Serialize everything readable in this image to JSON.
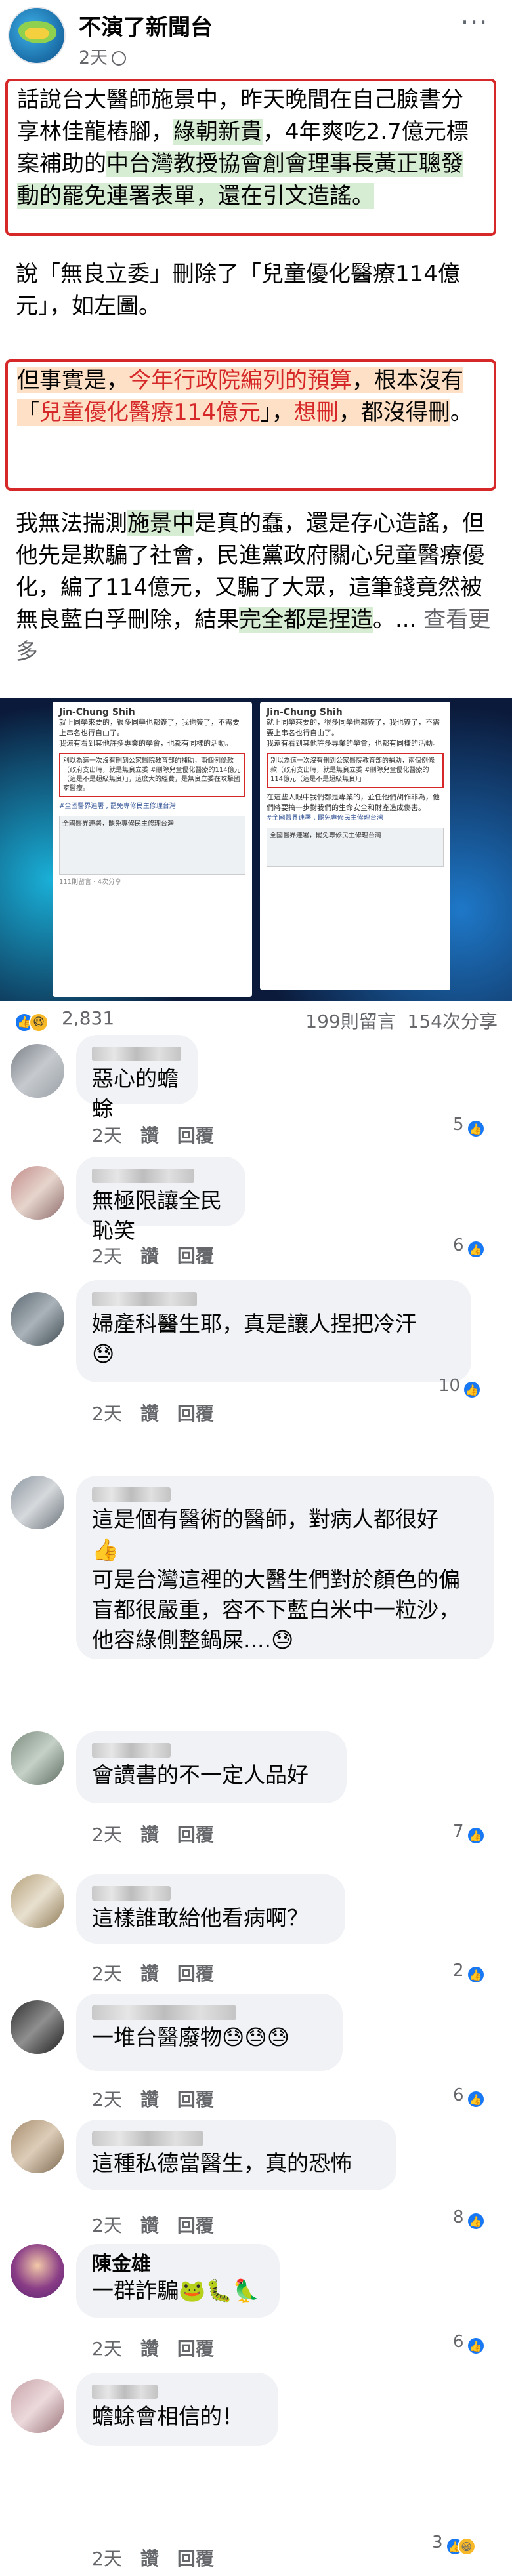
{
  "post": {
    "page_name": "不演了新聞台",
    "time": "2天",
    "paragraph1": {
      "part1": "話說台大醫師施景中，昨天晚間在自己臉書分享林佳龍樁腳，",
      "part2": "綠朝新貴",
      "part3": "，4年爽吃2.7億元標案補助的",
      "part4": "中台灣教授協會創會理事長黃正聰發動的罷免連署表單",
      "part5": "，還在引文造謠。"
    },
    "paragraph2": "說「無良立委」刪除了「兒童優化醫療114億元」，如左圖。",
    "paragraph3": {
      "part1": "但事實是，",
      "part2": "今年行政院編列的預算",
      "part3": "，根本沒有「",
      "part4": "兒童優化醫療114億元",
      "part5": "」，",
      "part6": "想刪",
      "part7": "，都沒得刪",
      "part8": "。"
    },
    "paragraph4": {
      "part1": "我無法揣測",
      "part2": "施景中",
      "part3": "是真的蠢，還是存心造謠，但他先是欺騙了社會，民進黨政府關心兒童醫療優化，編了114億元，又騙了大眾，這筆錢竟然被無良藍白孚刪除，結果",
      "part4": "完全都是捏造",
      "part5": "。...",
      "see_more": "查看更多"
    }
  },
  "screenshot": {
    "left_card": {
      "author": "Jin-Chung Shih",
      "line1": "就上同學來要的，很多同學也都簽了，我也簽了，不需要上串名也行自由了。",
      "line2": "我還有看到其他許多專業的學會，也都有同樣的活動。",
      "box": "別以為這一次沒有刪到公家醫院教育部的補助，兩個例條款（政府支出時，就是無良立委 #刪除兒童優化醫療的114億元（這是不是超級無良）」，這麼大的經費，是無良立委在攻擊國家醫療。",
      "link": "#全國醫界連署 , 罷免專修民主修理台灣",
      "preview_title": "全國醫界連署，罷免專修民主修理台灣",
      "footer": "111則留言 · 4次分享"
    },
    "right_card": {
      "author": "Jin-Chung Shih",
      "line1": "就上同學來要的，很多同學也都簽了，我也簽了，不需要上串名也行自由了。",
      "line2": "我還有看到其他許多專業的學會，也都有同樣的活動。",
      "box": "別以為這一次沒有刪到公家醫院教育部的補助，兩個例條款（政府支出時，就是無良立委 #刪除兒童優化醫療的114億元（這是不是超級無良）」",
      "line3": "在這些人眼中我們都是專業的，並任他們胡作非為，他們將要搞一步對我們的生命安全和財產造成傷害。",
      "link": "#全國醫界連署 , 罷免專修民主修理台灣",
      "preview_title": "全國醫界連署，罷免專修民主修理台灣"
    }
  },
  "stats": {
    "reactions": "2,831",
    "comments": "199則留言",
    "shares": "154次分享"
  },
  "actions": {
    "like": "讚",
    "reply": "回覆"
  },
  "comments": [
    {
      "text": "惡心的蟾蜍",
      "time": "2天",
      "reactions": "5"
    },
    {
      "text": "無極限讓全民恥笑",
      "time": "2天",
      "reactions": "6"
    },
    {
      "text": "婦產科醫生耶，真是讓人捏把冷汗",
      "text2": "😓",
      "time": "2天",
      "reactions": "10"
    },
    {
      "text": "這是個有醫術的醫師，對病人都很好",
      "text2": "👍",
      "text3": "可是台灣這裡的大醫生們對於顏色的偏盲都很嚴重，容不下藍白米中一粒沙，他容綠側整鍋屎....😓",
      "time": "2天",
      "reactions": ""
    },
    {
      "text": "會讀書的不一定人品好",
      "time": "2天",
      "reactions": "7"
    },
    {
      "text": "這樣誰敢給他看病啊？",
      "time": "2天",
      "reactions": "2"
    },
    {
      "text": "一堆台醫廢物😓😓😓",
      "time": "2天",
      "reactions": "6"
    },
    {
      "text": "這種私德當醫生，真的恐怖",
      "time": "2天",
      "reactions": "8"
    },
    {
      "name": "陳金雄",
      "text": "一群詐騙🐸🐛🦜",
      "time": "2天",
      "reactions": "6"
    },
    {
      "text": "蟾蜍會相信的！",
      "time": "2天",
      "reactions": "3"
    }
  ]
}
